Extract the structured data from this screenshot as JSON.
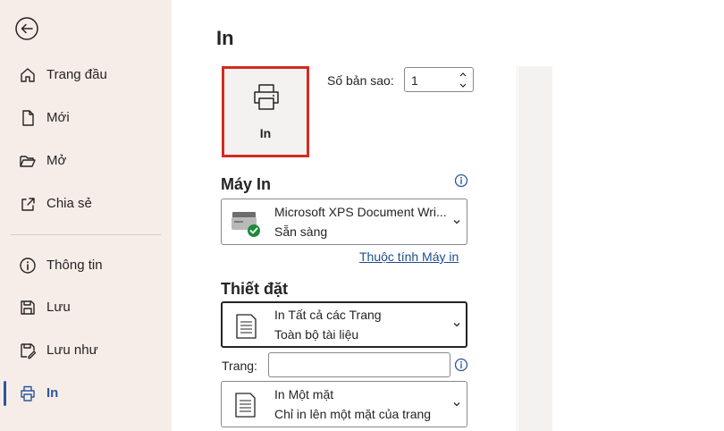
{
  "sidebar": {
    "back_icon": "back-arrow-icon",
    "items": [
      {
        "label": "Trang đầu",
        "icon": "home-icon"
      },
      {
        "label": "Mới",
        "icon": "new-document-icon"
      },
      {
        "label": "Mở",
        "icon": "open-folder-icon"
      },
      {
        "label": "Chia sẻ",
        "icon": "share-icon"
      },
      {
        "label": "Thông tin",
        "icon": "info-icon"
      },
      {
        "label": "Lưu",
        "icon": "save-icon"
      },
      {
        "label": "Lưu như",
        "icon": "save-as-icon"
      },
      {
        "label": "In",
        "icon": "printer-icon",
        "active": true
      }
    ]
  },
  "main": {
    "title": "In",
    "print_button": {
      "label": "In",
      "icon": "printer-icon"
    },
    "copies": {
      "label": "Số bản sao:",
      "value": "1"
    },
    "printer_section": {
      "title": "Máy In",
      "name": "Microsoft XPS Document Wri...",
      "status": "Sẵn sàng",
      "properties_link": "Thuộc tính Máy in"
    },
    "settings_section": {
      "title": "Thiết đặt",
      "scope": {
        "line1": "In Tất cả các Trang",
        "line2": "Toàn bộ tài liệu"
      },
      "pages": {
        "label": "Trang:",
        "value": ""
      },
      "sides": {
        "line1": "In Một mặt",
        "line2": "Chỉ in lên một mặt của trang"
      }
    }
  },
  "colors": {
    "sidebar_bg": "#f7ede8",
    "accent": "#2b579a",
    "highlight_border": "#d62a1f",
    "link": "#1e4e8c",
    "ready_badge": "#1f8a3c"
  }
}
